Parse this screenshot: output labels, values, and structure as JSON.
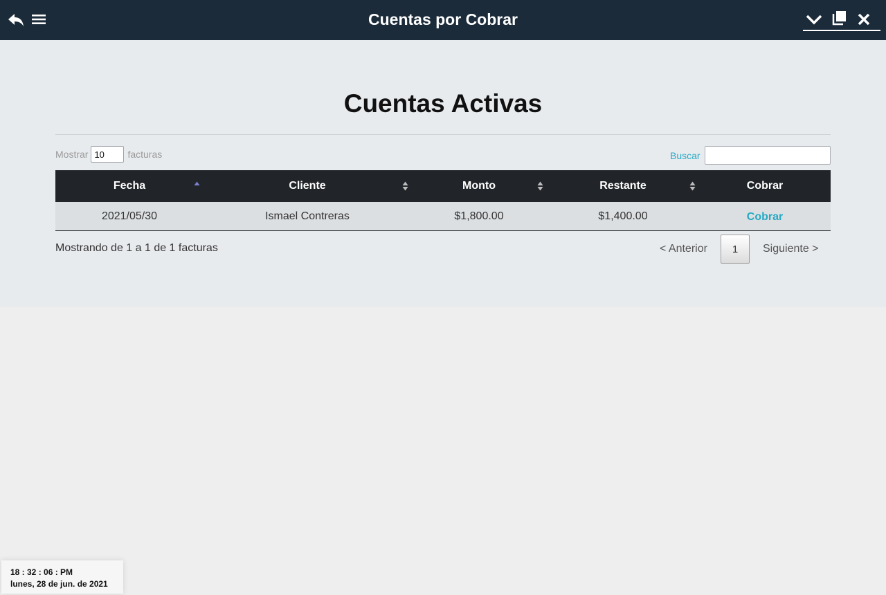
{
  "app": {
    "title": "Cuentas por Cobrar"
  },
  "icons": {
    "back": "back-arrow-icon",
    "menu": "hamburger-menu-icon",
    "minimize": "chevron-down-icon",
    "restore": "restore-window-icon",
    "close": "close-icon"
  },
  "page": {
    "heading": "Cuentas Activas"
  },
  "controls": {
    "show_label": "Mostrar",
    "show_value": "10",
    "show_suffix": "facturas",
    "search_label": "Buscar",
    "search_value": ""
  },
  "table": {
    "columns": [
      "Fecha",
      "Cliente",
      "Monto",
      "Restante",
      "Cobrar"
    ],
    "sorted_column": "Fecha",
    "sort_direction": "ascending",
    "rows": [
      {
        "fecha": "2021/05/30",
        "cliente": "Ismael Contreras",
        "monto": "$1,800.00",
        "restante": "$1,400.00",
        "accion": "Cobrar"
      }
    ]
  },
  "footer": {
    "info": "Mostrando de 1 a 1 de 1 facturas",
    "prev": "< Anterior",
    "current_page": "1",
    "next": "Siguiente >"
  },
  "clock": {
    "time": "18 : 32 : 06 : PM",
    "date": "lunes, 28 de jun. de 2021"
  },
  "colors": {
    "topbar": "#1c2b3a",
    "table_header": "#212529",
    "accent": "#26a9c4",
    "row_bg": "#dcdfe2",
    "panel_bg": "#e8ebee"
  }
}
